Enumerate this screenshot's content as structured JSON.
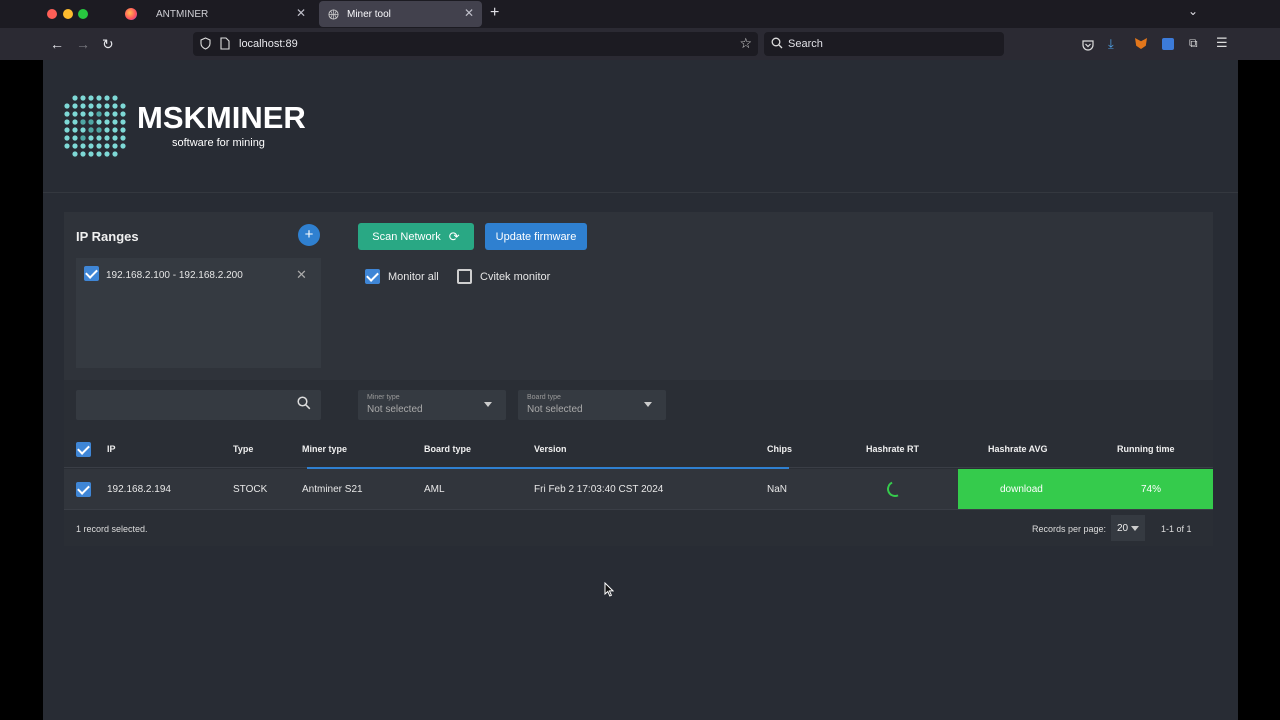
{
  "browser": {
    "tabs": [
      {
        "label": "ANTMINER",
        "icon": "firefox-icon",
        "active": false
      },
      {
        "label": "Miner tool",
        "icon": "globe-icon",
        "active": true
      }
    ],
    "url": "localhost:89",
    "search_placeholder": "Search"
  },
  "brand": {
    "title": "MSKMINER",
    "subtitle": "software for mining"
  },
  "ip_ranges": {
    "title": "IP Ranges",
    "add_label": "+",
    "items": [
      {
        "label": "192.168.2.100 - 192.168.2.200",
        "checked": true
      }
    ]
  },
  "actions": {
    "scan_label": "Scan Network",
    "update_label": "Update firmware",
    "monitor_all_label": "Monitor all",
    "cvitek_label": "Cvitek monitor"
  },
  "filters": {
    "miner_type_label": "Miner type",
    "miner_type_value": "Not selected",
    "board_type_label": "Board type",
    "board_type_value": "Not selected"
  },
  "table": {
    "columns": [
      "IP",
      "Type",
      "Miner type",
      "Board type",
      "Version",
      "Chips",
      "Hashrate RT",
      "Hashrate AVG",
      "Running time"
    ],
    "rows": [
      {
        "ip": "192.168.2.194",
        "type": "STOCK",
        "miner_type": "Antminer S21",
        "board_type": "AML",
        "version": "Fri Feb 2 17:03:40 CST 2024",
        "chips": "NaN",
        "hashrate_avg": "download",
        "running_time": "74%"
      }
    ],
    "footer": {
      "selected_text": "1 record selected.",
      "records_per_page_label": "Records per page:",
      "records_per_page_value": "20",
      "range_text": "1-1 of 1"
    }
  },
  "colors": {
    "accent_blue": "#2f80d0",
    "scan_green": "#29a884",
    "status_green": "#35cb4c"
  }
}
